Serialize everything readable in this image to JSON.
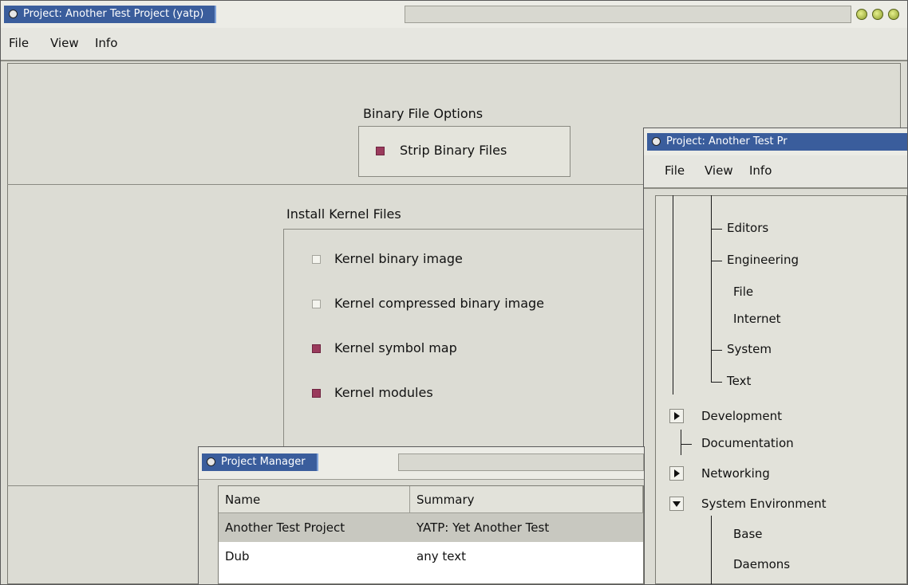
{
  "colors": {
    "title_active": "#3a5d9c",
    "checkbox_on": "#9a3a5c",
    "window_bg": "#dcdcd4"
  },
  "win_main": {
    "title": "Project: Another Test Project (yatp)",
    "menu": [
      "File",
      "View",
      "Info"
    ],
    "binary_group": {
      "label": "Binary File Options",
      "items": [
        {
          "label": "Strip Binary Files",
          "checked": true
        }
      ]
    },
    "kernel_group": {
      "label": "Install Kernel Files",
      "items": [
        {
          "label": "Kernel binary image",
          "checked": false
        },
        {
          "label": "Kernel compressed binary image",
          "checked": false
        },
        {
          "label": "Kernel symbol map",
          "checked": true
        },
        {
          "label": "Kernel modules",
          "checked": true
        }
      ]
    }
  },
  "win_tree": {
    "title": "Project: Another Test Pr",
    "menu": [
      "File",
      "View",
      "Info"
    ],
    "nodes": [
      {
        "label": "Editors",
        "expander": "none"
      },
      {
        "label": "Engineering",
        "expander": "none"
      },
      {
        "label": "File",
        "expander": "none"
      },
      {
        "label": "Internet",
        "expander": "none"
      },
      {
        "label": "System",
        "expander": "none"
      },
      {
        "label": "Text",
        "expander": "none"
      },
      {
        "label": "Development",
        "expander": "collapsed"
      },
      {
        "label": "Documentation",
        "expander": "none"
      },
      {
        "label": "Networking",
        "expander": "collapsed"
      },
      {
        "label": "System Environment",
        "expander": "expanded"
      },
      {
        "label": "Base",
        "expander": "none"
      },
      {
        "label": "Daemons",
        "expander": "none"
      }
    ]
  },
  "win_pm": {
    "title": "Project Manager",
    "columns": [
      "Name",
      "Summary"
    ],
    "rows": [
      {
        "name": "Another Test Project",
        "summary": "YATP: Yet Another Test",
        "selected": true
      },
      {
        "name": "Dub",
        "summary": "any text",
        "selected": false
      }
    ]
  }
}
